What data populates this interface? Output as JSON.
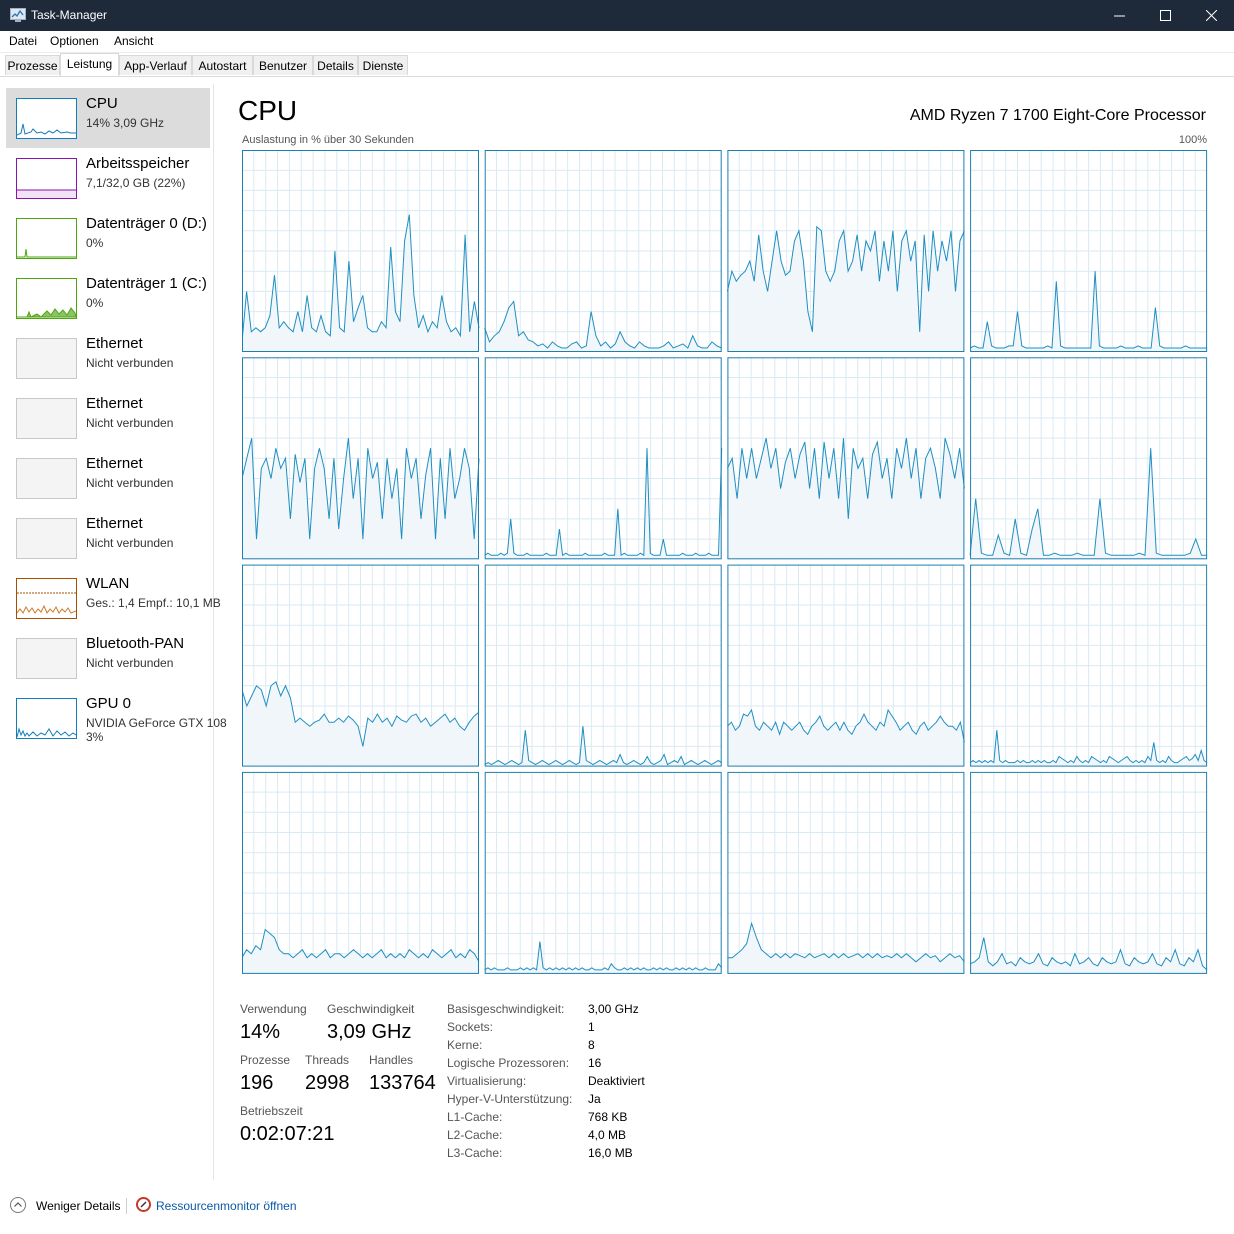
{
  "window": {
    "title": "Task-Manager"
  },
  "menu": [
    "Datei",
    "Optionen",
    "Ansicht"
  ],
  "tabs": [
    "Prozesse",
    "Leistung",
    "App-Verlauf",
    "Autostart",
    "Benutzer",
    "Details",
    "Dienste"
  ],
  "active_tab": "Leistung",
  "sidebar": [
    {
      "name": "CPU",
      "sub": "14%  3,09 GHz",
      "color": "#117dbb",
      "selected": true
    },
    {
      "name": "Arbeitsspeicher",
      "sub": "7,1/32,0 GB (22%)",
      "color": "#8b12ae"
    },
    {
      "name": "Datenträger 0 (D:)",
      "sub": "0%",
      "color": "#4da60c"
    },
    {
      "name": "Datenträger 1 (C:)",
      "sub": "0%",
      "color": "#4da60c"
    },
    {
      "name": "Ethernet",
      "sub": "Nicht verbunden"
    },
    {
      "name": "Ethernet",
      "sub": "Nicht verbunden"
    },
    {
      "name": "Ethernet",
      "sub": "Nicht verbunden"
    },
    {
      "name": "Ethernet",
      "sub": "Nicht verbunden"
    },
    {
      "name": "WLAN",
      "sub": "Ges.: 1,4  Empf.: 10,1 MB",
      "color": "#a74f01"
    },
    {
      "name": "Bluetooth-PAN",
      "sub": "Nicht verbunden"
    },
    {
      "name": "GPU 0",
      "sub": "NVIDIA GeForce GTX 108",
      "sub2": "3%",
      "color": "#117dbb"
    }
  ],
  "main": {
    "title": "CPU",
    "processor": "AMD Ryzen 7 1700 Eight-Core Processor",
    "caption_left": "Auslastung in % über 30 Sekunden",
    "caption_right": "100%"
  },
  "stats": {
    "usage_label": "Verwendung",
    "usage": "14%",
    "speed_label": "Geschwindigkeit",
    "speed": "3,09 GHz",
    "processes_label": "Prozesse",
    "processes": "196",
    "threads_label": "Threads",
    "threads": "2998",
    "handles_label": "Handles",
    "handles": "133764",
    "uptime_label": "Betriebszeit",
    "uptime": "0:02:07:21"
  },
  "specs": [
    {
      "k": "Basisgeschwindigkeit:",
      "v": "3,00 GHz"
    },
    {
      "k": "Sockets:",
      "v": "1"
    },
    {
      "k": "Kerne:",
      "v": "8"
    },
    {
      "k": "Logische Prozessoren:",
      "v": "16"
    },
    {
      "k": "Virtualisierung:",
      "v": "Deaktiviert"
    },
    {
      "k": "Hyper-V-Unterstützung:",
      "v": "Ja"
    },
    {
      "k": "L1-Cache:",
      "v": "768 KB"
    },
    {
      "k": "L2-Cache:",
      "v": "4,0 MB"
    },
    {
      "k": "L3-Cache:",
      "v": "16,0 MB"
    }
  ],
  "footer": {
    "less": "Weniger Details",
    "monitor": "Ressourcenmonitor öffnen"
  },
  "colors": {
    "cpu_line": "#1f8fc2",
    "cpu_fill": "#f1f6fa",
    "cpu_border": "#1d7fb0",
    "grid": "#d9eaf4"
  },
  "chart_data": {
    "type": "line",
    "title": "Auslastung in % über 30 Sekunden",
    "ylim": [
      0,
      100
    ],
    "series": [
      {
        "values": [
          5,
          30,
          10,
          12,
          10,
          12,
          18,
          38,
          12,
          15,
          12,
          10,
          20,
          10,
          28,
          12,
          10,
          18,
          10,
          8,
          50,
          12,
          10,
          45,
          15,
          22,
          28,
          12,
          10,
          10,
          15,
          12,
          52,
          20,
          15,
          55,
          68,
          28,
          12,
          18,
          10,
          15,
          12,
          28,
          15,
          10,
          12,
          8,
          58,
          10,
          25,
          12
        ]
      },
      {
        "values": [
          12,
          5,
          8,
          10,
          15,
          22,
          25,
          8,
          10,
          6,
          5,
          3,
          4,
          2,
          5,
          3,
          2,
          2,
          4,
          5,
          2,
          3,
          20,
          8,
          3,
          5,
          2,
          4,
          10,
          5,
          3,
          2,
          5,
          3,
          2,
          2,
          2,
          3,
          5,
          2,
          3,
          4,
          2,
          8,
          3,
          2,
          2,
          5,
          3,
          2
        ]
      },
      {
        "values": [
          30,
          40,
          35,
          38,
          40,
          45,
          35,
          58,
          40,
          30,
          45,
          60,
          45,
          38,
          40,
          55,
          60,
          45,
          20,
          10,
          62,
          60,
          40,
          35,
          40,
          55,
          60,
          40,
          45,
          58,
          40,
          55,
          50,
          60,
          35,
          55,
          40,
          60,
          30,
          55,
          60,
          45,
          55,
          10,
          58,
          30,
          60,
          40,
          55,
          45,
          60,
          30,
          55,
          60
        ]
      },
      {
        "values": [
          2,
          3,
          2,
          2,
          15,
          3,
          2,
          2,
          2,
          3,
          3,
          20,
          3,
          2,
          2,
          2,
          2,
          2,
          3,
          2,
          35,
          3,
          2,
          2,
          2,
          2,
          2,
          2,
          2,
          40,
          3,
          2,
          2,
          2,
          2,
          3,
          2,
          2,
          2,
          3,
          2,
          2,
          2,
          22,
          3,
          2,
          2,
          2,
          2,
          2,
          3,
          2,
          2,
          2,
          2,
          2
        ]
      },
      {
        "values": [
          40,
          50,
          60,
          10,
          45,
          50,
          40,
          55,
          45,
          50,
          20,
          52,
          38,
          50,
          10,
          45,
          55,
          45,
          20,
          50,
          15,
          40,
          60,
          30,
          50,
          10,
          55,
          40,
          48,
          20,
          50,
          30,
          45,
          10,
          55,
          40,
          50,
          20,
          42,
          55,
          10,
          50,
          20,
          55,
          30,
          40,
          55,
          45,
          10,
          50
        ]
      },
      {
        "values": [
          2,
          3,
          2,
          2,
          2,
          3,
          2,
          3,
          20,
          3,
          2,
          2,
          2,
          3,
          2,
          2,
          2,
          2,
          2,
          3,
          2,
          2,
          2,
          15,
          2,
          3,
          2,
          2,
          2,
          2,
          2,
          3,
          2,
          2,
          2,
          2,
          2,
          3,
          2,
          2,
          2,
          25,
          2,
          3,
          2,
          2,
          2,
          2,
          3,
          2,
          55,
          3,
          2,
          2,
          2,
          10,
          2,
          2,
          2,
          2,
          2,
          3,
          2,
          2,
          2,
          3,
          2,
          2,
          2,
          3,
          2,
          2,
          2,
          55
        ]
      },
      {
        "values": [
          45,
          50,
          30,
          55,
          40,
          55,
          40,
          50,
          60,
          45,
          55,
          35,
          48,
          55,
          40,
          52,
          58,
          35,
          55,
          30,
          58,
          40,
          55,
          30,
          60,
          20,
          55,
          45,
          50,
          30,
          52,
          58,
          40,
          50,
          30,
          55,
          45,
          60,
          40,
          55,
          30,
          50,
          55,
          45,
          30,
          60,
          52,
          40,
          55,
          35
        ]
      },
      {
        "values": [
          2,
          30,
          3,
          2,
          2,
          12,
          3,
          2,
          20,
          3,
          2,
          15,
          25,
          2,
          2,
          3,
          2,
          2,
          2,
          3,
          2,
          2,
          2,
          30,
          3,
          2,
          2,
          2,
          2,
          2,
          3,
          2,
          55,
          3,
          2,
          2,
          2,
          2,
          2,
          3,
          10,
          2,
          2
        ]
      },
      {
        "values": [
          38,
          30,
          35,
          40,
          38,
          30,
          40,
          42,
          35,
          40,
          34,
          22,
          24,
          22,
          20,
          22,
          23,
          26,
          22,
          22,
          24,
          22,
          25,
          23,
          20,
          10,
          24,
          22,
          26,
          22,
          24,
          20,
          25,
          23,
          22,
          25,
          26,
          22,
          24,
          20,
          22,
          24,
          26,
          22,
          24,
          20,
          18,
          22,
          25,
          27
        ]
      },
      {
        "values": [
          1,
          2,
          1,
          2,
          3,
          2,
          1,
          2,
          3,
          2,
          1,
          2,
          18,
          3,
          2,
          1,
          2,
          3,
          2,
          1,
          2,
          3,
          2,
          1,
          2,
          3,
          2,
          1,
          2,
          20,
          3,
          2,
          1,
          2,
          3,
          2,
          1,
          2,
          3,
          2,
          6,
          2,
          1,
          2,
          3,
          2,
          1,
          2,
          5,
          2,
          1,
          2,
          3,
          6,
          1,
          2,
          3,
          2,
          5,
          1,
          2,
          3,
          2,
          1,
          2,
          3,
          2,
          1,
          2,
          3,
          2
        ]
      },
      {
        "values": [
          20,
          22,
          18,
          20,
          26,
          25,
          28,
          20,
          18,
          22,
          20,
          18,
          22,
          16,
          22,
          20,
          18,
          20,
          22,
          18,
          16,
          20,
          22,
          25,
          20,
          18,
          20,
          22,
          18,
          22,
          18,
          16,
          20,
          22,
          26,
          22,
          20,
          18,
          22,
          20,
          28,
          25,
          22,
          18,
          20,
          22,
          18,
          16,
          20,
          22,
          18,
          20,
          22,
          25,
          22,
          20,
          20,
          18,
          22,
          12
        ]
      },
      {
        "values": [
          2,
          3,
          2,
          3,
          2,
          3,
          2,
          3,
          2,
          18,
          3,
          2,
          3,
          2,
          2,
          2,
          3,
          2,
          3,
          2,
          2,
          3,
          2,
          3,
          2,
          3,
          2,
          2,
          3,
          2,
          5,
          4,
          3,
          2,
          3,
          2,
          5,
          3,
          2,
          3,
          2,
          5,
          4,
          3,
          2,
          3,
          2,
          5,
          4,
          3,
          2,
          3,
          4,
          5,
          3,
          2,
          3,
          2,
          3,
          2,
          5,
          3,
          12,
          3,
          2,
          3,
          2,
          5,
          3,
          2,
          2,
          3,
          4,
          5,
          3,
          4,
          6,
          3,
          8,
          3,
          2
        ]
      },
      {
        "values": [
          8,
          12,
          10,
          14,
          12,
          22,
          20,
          18,
          12,
          10,
          10,
          8,
          10,
          12,
          8,
          10,
          8,
          10,
          12,
          8,
          10,
          10,
          8,
          10,
          12,
          10,
          8,
          10,
          8,
          10,
          12,
          8,
          10,
          8,
          10,
          8,
          12,
          10,
          8,
          10,
          8,
          12,
          10,
          8,
          10,
          12,
          8,
          10,
          8,
          12,
          10,
          6
        ]
      },
      {
        "values": [
          2,
          3,
          2,
          3,
          2,
          2,
          2,
          3,
          2,
          2,
          2,
          3,
          2,
          3,
          2,
          3,
          2,
          16,
          3,
          2,
          3,
          2,
          3,
          2,
          3,
          2,
          3,
          2,
          3,
          2,
          3,
          2,
          2,
          3,
          2,
          2,
          2,
          3,
          2,
          5,
          3,
          2,
          2,
          3,
          2,
          3,
          2,
          3,
          2,
          3,
          2,
          2,
          3,
          2,
          3,
          2,
          3,
          2,
          2,
          3,
          2,
          3,
          2,
          3,
          2,
          3,
          2,
          2,
          3,
          2,
          2,
          2,
          5,
          3
        ]
      },
      {
        "values": [
          8,
          8,
          10,
          12,
          15,
          25,
          18,
          12,
          10,
          8,
          10,
          8,
          10,
          8,
          10,
          9,
          8,
          10,
          8,
          9,
          10,
          8,
          10,
          8,
          10,
          8,
          9,
          10,
          8,
          10,
          8,
          10,
          8,
          9,
          8,
          10,
          8,
          10,
          8,
          6,
          8,
          10,
          8,
          9,
          6,
          8,
          10,
          8,
          9,
          6
        ]
      },
      {
        "values": [
          5,
          6,
          8,
          18,
          6,
          4,
          6,
          10,
          5,
          6,
          4,
          8,
          6,
          5,
          6,
          10,
          5,
          4,
          8,
          6,
          5,
          6,
          4,
          10,
          5,
          6,
          8,
          5,
          4,
          8,
          6,
          5,
          6,
          12,
          5,
          4,
          8,
          6,
          5,
          6,
          10,
          5,
          4,
          8,
          6,
          12,
          5,
          4,
          8,
          6,
          12,
          4,
          2
        ]
      }
    ]
  }
}
